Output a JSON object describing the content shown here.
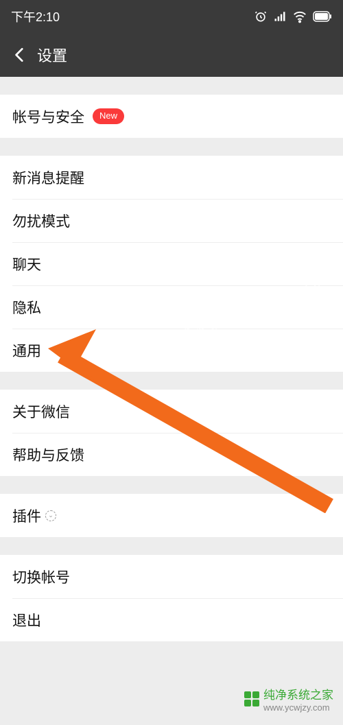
{
  "status": {
    "time": "下午2:10"
  },
  "nav": {
    "title": "设置"
  },
  "sections": {
    "account": {
      "label": "帐号与安全",
      "badge": "New"
    },
    "notif": {
      "label": "新消息提醒"
    },
    "dnd": {
      "label": "勿扰模式"
    },
    "chat": {
      "label": "聊天"
    },
    "privacy": {
      "label": "隐私"
    },
    "general": {
      "label": "通用"
    },
    "about": {
      "label": "关于微信"
    },
    "help": {
      "label": "帮助与反馈"
    },
    "plugin": {
      "label": "插件"
    },
    "switch": {
      "label": "切换帐号"
    },
    "logout": {
      "label": "退出"
    }
  },
  "watermark": {
    "text1": "纯净系统之家 ycwjzy.com",
    "brand": "纯净系统之家",
    "site": "www.ycwjzy.com"
  }
}
